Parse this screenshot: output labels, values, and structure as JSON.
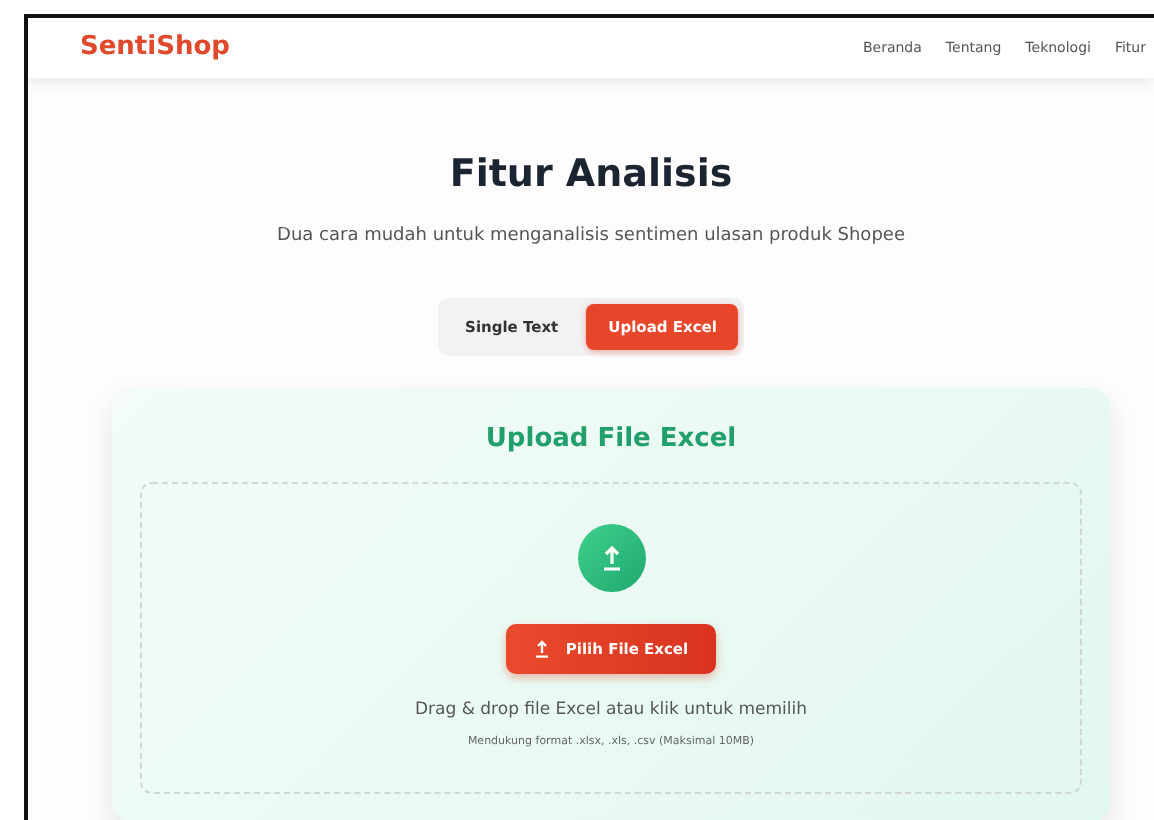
{
  "navbar": {
    "brand": "SentiShop",
    "links": [
      "Beranda",
      "Tentang",
      "Teknologi",
      "Fitur"
    ]
  },
  "header": {
    "title": "Fitur Analisis",
    "subtitle": "Dua cara mudah untuk menganalisis sentimen ulasan produk Shopee"
  },
  "tabs": [
    {
      "label": "Single Text",
      "selected": false
    },
    {
      "label": "Upload Excel",
      "selected": true
    }
  ],
  "upload": {
    "title": "Upload File Excel",
    "button": "Pilih File Excel",
    "hint": "Drag & drop file Excel atau klik untuk memilih",
    "note": "Mendukung format .xlsx, .xls, .csv (Maksimal 10MB)"
  }
}
